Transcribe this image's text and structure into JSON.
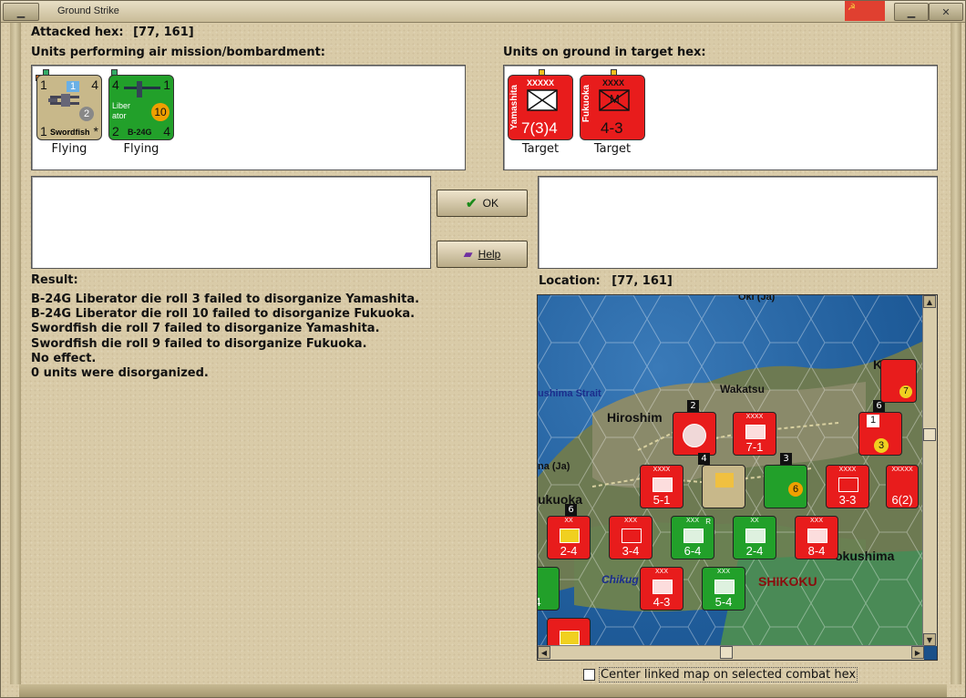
{
  "window": {
    "title": "Ground Strike"
  },
  "header": {
    "attacked_hex_label": "Attacked hex:",
    "attacked_hex_value": "[77, 161]"
  },
  "air_units": {
    "label": "Units performing air mission/bombardment:",
    "units": [
      {
        "name": "Swordfish",
        "status": "Flying",
        "top_left": "1",
        "top_right": "4",
        "bottom_left": "1",
        "bottom_right": "*",
        "badge_blue": "1",
        "badge_grey": "2",
        "color": "#c8b88a"
      },
      {
        "name": "B-24G",
        "name2": "Liber ator",
        "status": "Flying",
        "top_left": "4",
        "top_right": "1",
        "bottom_left": "2",
        "bottom_right": "4",
        "badge_orange": "10",
        "color": "#22a02a"
      }
    ]
  },
  "ground_units": {
    "label": "Units on ground in target hex:",
    "units": [
      {
        "name": "Yamashita",
        "size": "XXXXX",
        "value": "7(3)4",
        "status": "Target",
        "color": "#e81c1c"
      },
      {
        "name": "Fukuoka",
        "size": "XXXX",
        "symbol": "M",
        "value": "4-3",
        "status": "Target",
        "color": "#e81c1c"
      }
    ]
  },
  "buttons": {
    "ok_label": "OK",
    "help_label": "Help"
  },
  "result": {
    "label": "Result:",
    "lines": [
      "B-24G Liberator die roll 3 failed to disorganize Yamashita.",
      "B-24G Liberator die roll 10 failed to disorganize Fukuoka.",
      "Swordfish die roll 7 failed to disorganize Yamashita.",
      "Swordfish die roll 9 failed to disorganize Fukuoka.",
      "No effect.",
      "0 units were disorganized."
    ]
  },
  "location": {
    "label": "Location:",
    "value": "[77, 161]"
  },
  "map": {
    "labels": {
      "oki": "Oki (Ja)",
      "strait": "ushima Strait",
      "wakatsu": "Wakatsu",
      "hiroshima": "Hiroshim",
      "ky": "Ky",
      "ja": "na (Ja)",
      "fukuoka": "ukuoka",
      "chikugo": "Chikug",
      "tokushima": "okushima",
      "shikoku": "SHIKOKU"
    },
    "counters": [
      {
        "val": "7-1",
        "top": "XXXX",
        "stack": "4"
      },
      {
        "val": "5-1",
        "top": "XXXX",
        "stack": "6"
      },
      {
        "val": "3-3",
        "top": "XXXX",
        "stack": "2"
      },
      {
        "val": "6(2)",
        "top": "XXXXX",
        "stack": "4"
      },
      {
        "val": "2-4",
        "top": "XX",
        "stack": "2"
      },
      {
        "val": "3-4",
        "top": "XXX",
        "stack": "2"
      },
      {
        "val": "6-4",
        "top": "XXX",
        "stack": "2",
        "flag": "R"
      },
      {
        "val": "2-4",
        "top": "XX",
        "stack": "2"
      },
      {
        "val": "8-4",
        "top": "XXX",
        "stack": "2"
      },
      {
        "val": "4-3",
        "top": "XXX",
        "stack": "2"
      },
      {
        "val": "5-4",
        "top": "XXX",
        "stack": "2"
      },
      {
        "val": "4",
        "top": "",
        "stack": "2"
      }
    ],
    "stack_counts": [
      "2",
      "2",
      "4",
      "3",
      "6",
      "2",
      "6"
    ]
  },
  "options": {
    "center_map_label": "Center linked map on selected combat hex",
    "center_map_checked": false
  }
}
